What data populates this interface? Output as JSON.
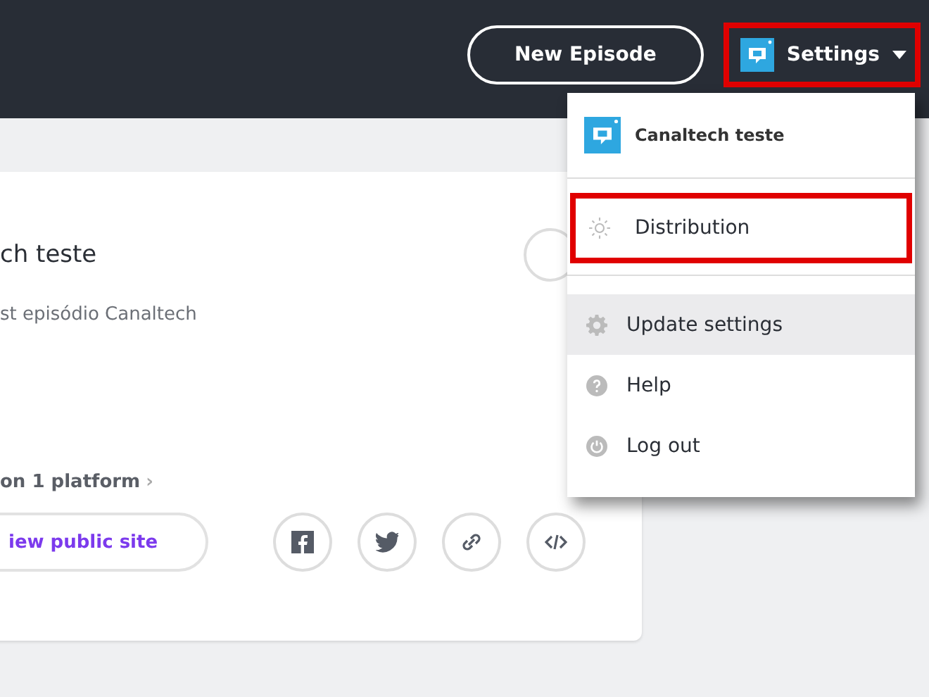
{
  "top_bar": {
    "new_episode_button": "New Episode",
    "settings_menu": {
      "label": "Settings",
      "highlighted": true,
      "expanded": true
    }
  },
  "podcast_card": {
    "title": "ch teste",
    "description": "st episódio Canaltech",
    "platforms_link": "on 1 platform",
    "chevron": "›",
    "public_site_button": "iew public site",
    "share_buttons": [
      {
        "kind": "facebook"
      },
      {
        "kind": "twitter"
      },
      {
        "kind": "link"
      },
      {
        "kind": "embed"
      }
    ]
  },
  "dropdown": {
    "podcast_name": "Canaltech teste",
    "item_groups": [
      [
        {
          "kind": "distribution",
          "label": "Distribution",
          "highlighted": true,
          "hovered": false
        }
      ],
      [
        {
          "kind": "settings",
          "label": "Update settings",
          "highlighted": false,
          "hovered": true
        },
        {
          "kind": "help",
          "label": "Help",
          "highlighted": false,
          "hovered": false
        },
        {
          "kind": "logout",
          "label": "Log out",
          "highlighted": false,
          "hovered": false
        }
      ]
    ]
  }
}
